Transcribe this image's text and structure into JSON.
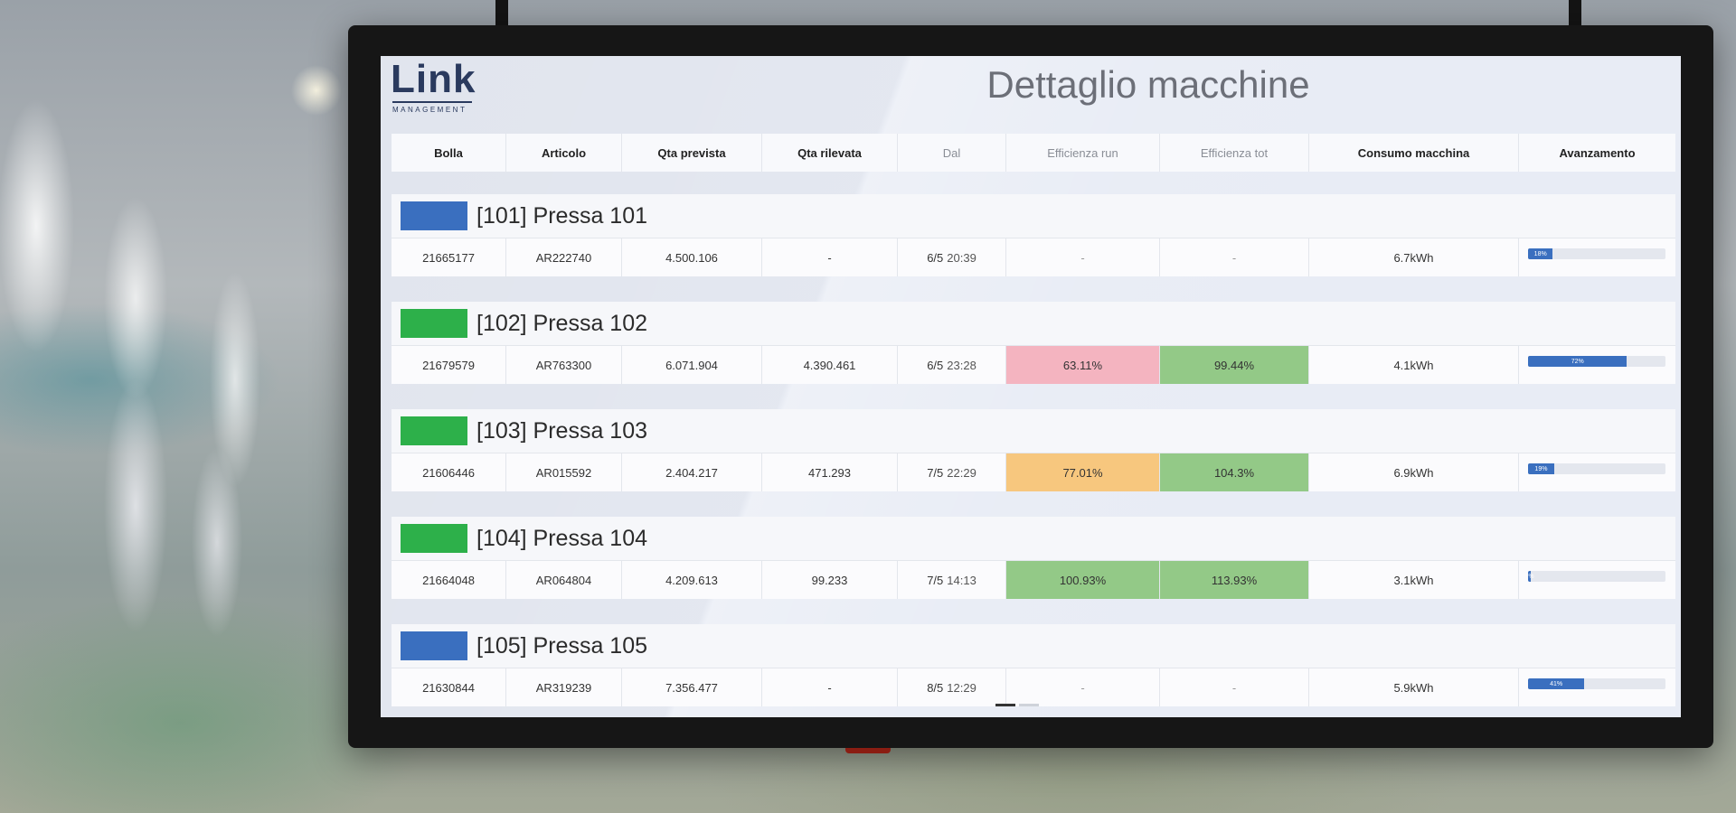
{
  "app": {
    "logo_text": "Link",
    "logo_subtitle": "MANAGEMENT",
    "title": "Dettaglio macchine"
  },
  "columns": [
    "Bolla",
    "Articolo",
    "Qta prevista",
    "Qta rilevata",
    "Dal",
    "Efficienza run",
    "Efficienza tot",
    "Consumo macchina",
    "Avanzamento"
  ],
  "colors": {
    "status_blue": "#3a6fbf",
    "status_green": "#2db04a",
    "eff_red": "#f4b4c0",
    "eff_orange": "#f7c77e",
    "eff_green": "#93c987"
  },
  "machines": [
    {
      "name": "[101] Pressa 101",
      "status": "blue",
      "bolla": "21665177",
      "articolo": "AR222740",
      "qta_prevista": "4.500.106",
      "qta_rilevata": "-",
      "dal_day": "6/5",
      "dal_time": "20:39",
      "eff_run": "-",
      "eff_run_color": "none",
      "eff_tot": "-",
      "eff_tot_color": "none",
      "consumo": "6.7kWh",
      "avanzamento": 18,
      "avanzamento_label": "18%"
    },
    {
      "name": "[102] Pressa 102",
      "status": "green",
      "bolla": "21679579",
      "articolo": "AR763300",
      "qta_prevista": "6.071.904",
      "qta_rilevata": "4.390.461",
      "dal_day": "6/5",
      "dal_time": "23:28",
      "eff_run": "63.11%",
      "eff_run_color": "red",
      "eff_tot": "99.44%",
      "eff_tot_color": "green",
      "consumo": "4.1kWh",
      "avanzamento": 72,
      "avanzamento_label": "72%"
    },
    {
      "name": "[103] Pressa 103",
      "status": "green",
      "bolla": "21606446",
      "articolo": "AR015592",
      "qta_prevista": "2.404.217",
      "qta_rilevata": "471.293",
      "dal_day": "7/5",
      "dal_time": "22:29",
      "eff_run": "77.01%",
      "eff_run_color": "orange",
      "eff_tot": "104.3%",
      "eff_tot_color": "green",
      "consumo": "6.9kWh",
      "avanzamento": 19,
      "avanzamento_label": "19%"
    },
    {
      "name": "[104] Pressa 104",
      "status": "green",
      "bolla": "21664048",
      "articolo": "AR064804",
      "qta_prevista": "4.209.613",
      "qta_rilevata": "99.233",
      "dal_day": "7/5",
      "dal_time": "14:13",
      "eff_run": "100.93%",
      "eff_run_color": "green",
      "eff_tot": "113.93%",
      "eff_tot_color": "green",
      "consumo": "3.1kWh",
      "avanzamento": 2,
      "avanzamento_label": "2%"
    },
    {
      "name": "[105] Pressa 105",
      "status": "blue",
      "bolla": "21630844",
      "articolo": "AR319239",
      "qta_prevista": "7.356.477",
      "qta_rilevata": "-",
      "dal_day": "8/5",
      "dal_time": "12:29",
      "eff_run": "-",
      "eff_run_color": "none",
      "eff_tot": "-",
      "eff_tot_color": "none",
      "consumo": "5.9kWh",
      "avanzamento": 41,
      "avanzamento_label": "41%"
    }
  ]
}
